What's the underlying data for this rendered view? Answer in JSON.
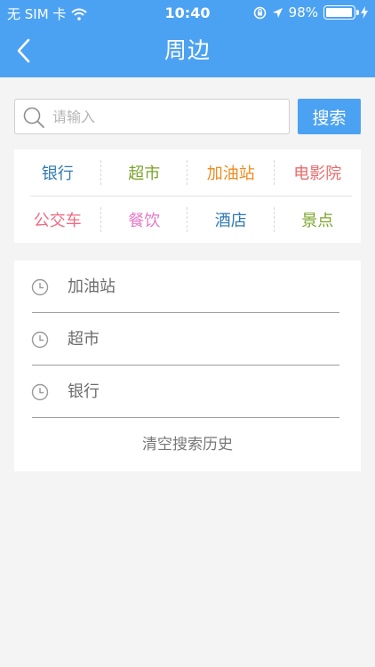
{
  "status_bar": {
    "carrier": "无 SIM 卡",
    "time": "10:40",
    "battery_percent": "98%",
    "battery_level": 0.98
  },
  "header": {
    "title": "周边",
    "back_icon": "chevron-left-icon"
  },
  "search": {
    "placeholder": "请输入",
    "button_label": "搜索"
  },
  "categories": [
    {
      "label": "银行",
      "color": "#2f79b3"
    },
    {
      "label": "超市",
      "color": "#7ba32b"
    },
    {
      "label": "加油站",
      "color": "#f08a1e"
    },
    {
      "label": "电影院",
      "color": "#ea6b6b"
    },
    {
      "label": "公交车",
      "color": "#ee6b82"
    },
    {
      "label": "餐饮",
      "color": "#e479c6"
    },
    {
      "label": "酒店",
      "color": "#2f79b3"
    },
    {
      "label": "景点",
      "color": "#7ba32b"
    }
  ],
  "history": {
    "items": [
      {
        "label": "加油站"
      },
      {
        "label": "超市"
      },
      {
        "label": "银行"
      }
    ],
    "clear_label": "清空搜索历史"
  },
  "colors": {
    "accent": "#4ca2f2"
  }
}
